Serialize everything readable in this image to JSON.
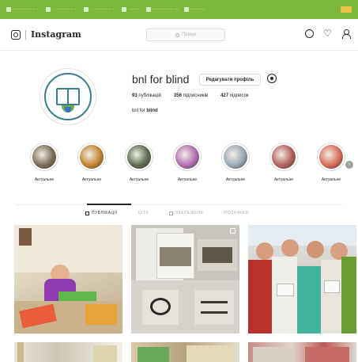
{
  "browser": {
    "bookmarks": [
      {
        "label": "··· ·········· · ·",
        "icon": "bookmark-icon"
      },
      {
        "label": "·· ·········· · ·",
        "icon": "bookmark-icon"
      },
      {
        "label": "·· ·········· · ·",
        "icon": "bookmark-icon"
      },
      {
        "label": "··· ····",
        "icon": "bookmark-icon"
      },
      {
        "label": "··· ········· ···",
        "icon": "bookmark-icon"
      },
      {
        "label": "·········",
        "icon": "bookmark-icon"
      }
    ],
    "accent": "#7cb83a"
  },
  "header": {
    "logo": "Instagram",
    "search_placeholder": "Пошук",
    "icons": [
      "compass-icon",
      "heart-icon",
      "profile-icon"
    ]
  },
  "profile": {
    "username": "bnl for blind",
    "edit_label": "Редагувати профіль",
    "stats": {
      "posts": {
        "value": "93",
        "label": "публікацій"
      },
      "followers": {
        "value": "356",
        "label": "підписників"
      },
      "following": {
        "value": "427",
        "label": "підписок"
      }
    },
    "full_name_prefix": "bnl for",
    "full_name_bold": "blind"
  },
  "highlights": [
    {
      "label": "Актуальне",
      "color": "#7b6b55"
    },
    {
      "label": "Актуальне",
      "color": "#c4842f"
    },
    {
      "label": "Актуальне",
      "color": "#5b6b4d"
    },
    {
      "label": "Актуальне",
      "color": "#b46cb0"
    },
    {
      "label": "Актуальне",
      "color": "#9aa7b3"
    },
    {
      "label": "Актуальне",
      "color": "#b35e5a"
    },
    {
      "label": "Актуальне",
      "color": "#d96b55"
    }
  ],
  "tabs": [
    {
      "label": "ПУБЛІКАЦІЇ",
      "active": true
    },
    {
      "label": "IGTV",
      "active": false
    },
    {
      "label": "ЗБЕРЕЖЕНЕ",
      "active": false
    },
    {
      "label": "ПОЗНАЧКИ",
      "active": false
    }
  ]
}
